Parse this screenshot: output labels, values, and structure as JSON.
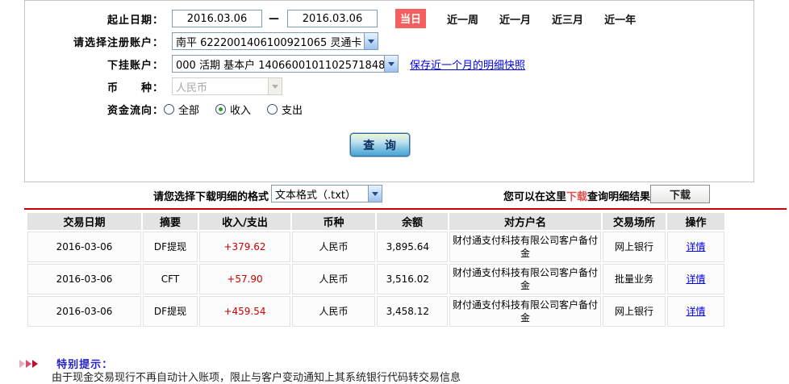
{
  "colors": {
    "today_badge": "#f65f5f",
    "divider_red": "#c70011",
    "amount_red": "#cc0000",
    "link_blue": "#0000ee",
    "tips_blue": "#2222cc",
    "header_gray": "#e3e3e3"
  },
  "form": {
    "date_range": {
      "label": "起止日期：",
      "start": "2016.03.06",
      "separator": "—",
      "end": "2016.03.06"
    },
    "quick_ranges": {
      "today": "当日",
      "week": "近一周",
      "month": "近一月",
      "quarter": "近三月",
      "year": "近一年"
    },
    "register_account": {
      "label": "请选择注册账户：",
      "value": "南平  6222001406100921065  灵通卡"
    },
    "sub_account": {
      "label": "下挂账户：",
      "value": "000  活期  基本户  1406600101102571848",
      "snapshot_link": "保存近一个月的明细快照"
    },
    "currency": {
      "label": "币　　种：",
      "value": "人民币"
    },
    "flow": {
      "label": "资金流向：",
      "options": [
        {
          "label": "全部",
          "selected": false
        },
        {
          "label": "收入",
          "selected": true
        },
        {
          "label": "支出",
          "selected": false
        }
      ]
    },
    "query_button": "查 询"
  },
  "download": {
    "format_label": "请您选择下载明细的格式",
    "format_value": "文本格式（.txt）",
    "hint_prefix": "您可以在这里",
    "hint_red": "下载",
    "hint_suffix": "查询明细结果",
    "button": "下载"
  },
  "table": {
    "headers": [
      "交易日期",
      "摘要",
      "收入/支出",
      "币种",
      "余额",
      "对方户名",
      "交易场所",
      "操作"
    ],
    "rows": [
      {
        "date": "2016-03-06",
        "summary": "DF提现",
        "amount": "+379.62",
        "currency": "人民币",
        "balance": "3,895.64",
        "counterparty": "财付通支付科技有限公司客户备付金",
        "channel": "网上银行",
        "action": "详情"
      },
      {
        "date": "2016-03-06",
        "summary": "CFT",
        "amount": "+57.90",
        "currency": "人民币",
        "balance": "3,516.02",
        "counterparty": "财付通支付科技有限公司客户备付金",
        "channel": "批量业务",
        "action": "详情"
      },
      {
        "date": "2016-03-06",
        "summary": "DF提现",
        "amount": "+459.54",
        "currency": "人民币",
        "balance": "3,458.12",
        "counterparty": "财付通支付科技有限公司客户备付金",
        "channel": "网上银行",
        "action": "详情"
      }
    ]
  },
  "tips": {
    "title": "特别提示：",
    "line1": "由于现金交易现行不再自动计入账项，限止与客户变动通知上其系统银行代码转交易信息"
  }
}
